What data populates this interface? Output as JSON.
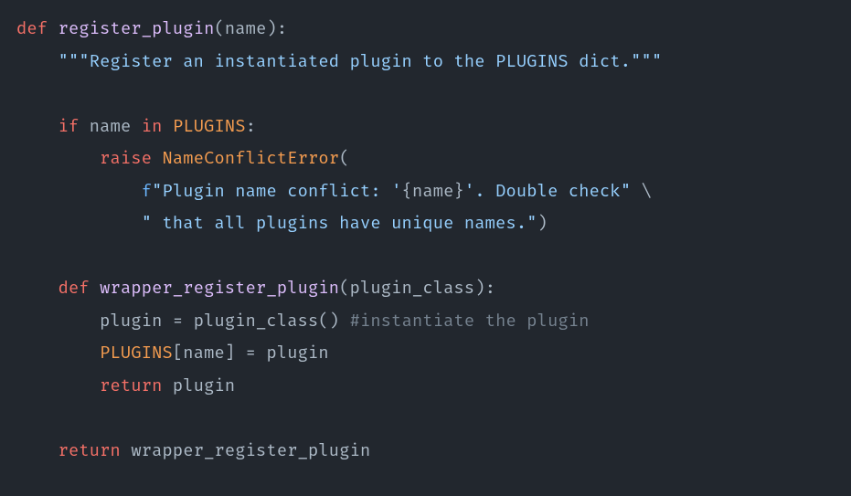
{
  "code": {
    "line1": {
      "def": "def",
      "sp": " ",
      "fn": "register_plugin",
      "lp": "(",
      "arg": "name",
      "rp": "):"
    },
    "line2": {
      "indent": "    ",
      "doc": "\"\"\"Register an instantiated plugin to the PLUGINS dict.\"\"\""
    },
    "line3": "",
    "line4": {
      "indent": "    ",
      "if": "if",
      "sp1": " ",
      "name": "name",
      "sp2": " ",
      "in": "in",
      "sp3": " ",
      "plugins": "PLUGINS",
      "colon": ":"
    },
    "line5": {
      "indent": "        ",
      "raise": "raise",
      "sp": " ",
      "err": "NameConflictError",
      "lp": "("
    },
    "line6": {
      "indent": "            ",
      "f": "f",
      "s1": "\"Plugin name conflict: '",
      "lb": "{",
      "name": "name",
      "rb": "}",
      "s2": "'. Double check\"",
      "cont": " \\"
    },
    "line7": {
      "indent": "            ",
      "s": "\" that all plugins have unique names.\"",
      "rp": ")"
    },
    "line8": "",
    "line9": {
      "indent": "    ",
      "def": "def",
      "sp": " ",
      "fn": "wrapper_register_plugin",
      "lp": "(",
      "arg": "plugin_class",
      "rp": "):"
    },
    "line10": {
      "indent": "        ",
      "lhs": "plugin",
      "eq": " = ",
      "call": "plugin_class",
      "paren": "()",
      "sp": " ",
      "cmt": "#instantiate the plugin"
    },
    "line11": {
      "indent": "        ",
      "plugins": "PLUGINS",
      "lb": "[",
      "name": "name",
      "rb": "]",
      "eq": " = ",
      "rhs": "plugin"
    },
    "line12": {
      "indent": "        ",
      "ret": "return",
      "sp": " ",
      "val": "plugin"
    },
    "line13": "",
    "line14": {
      "indent": "    ",
      "ret": "return",
      "sp": " ",
      "val": "wrapper_register_plugin"
    }
  }
}
